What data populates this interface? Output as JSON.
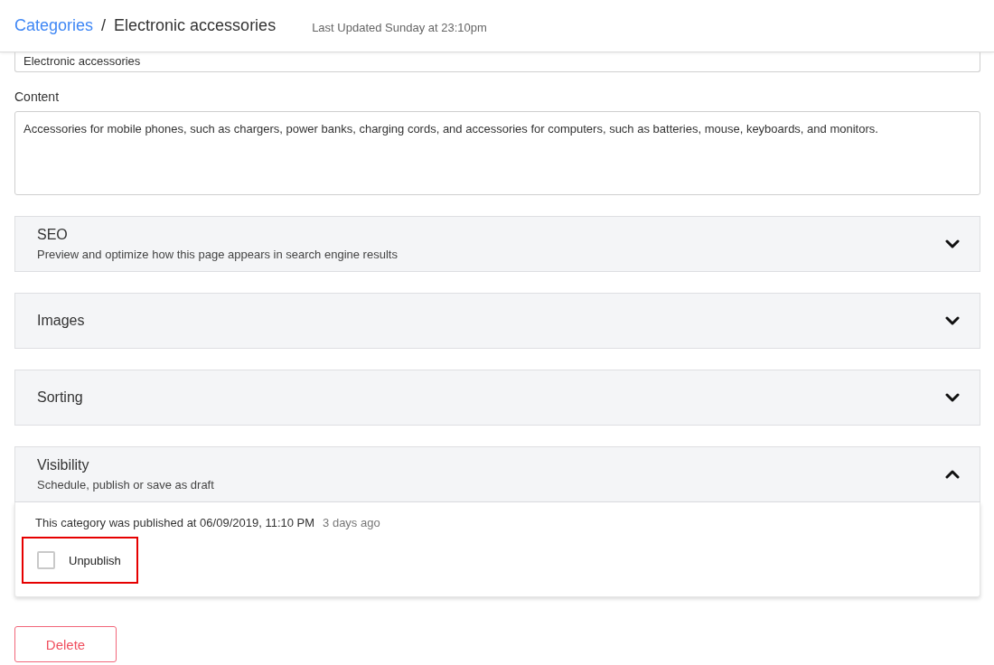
{
  "header": {
    "breadcrumb": [
      {
        "label": "Categories",
        "kind": "link"
      },
      {
        "label": "/",
        "kind": "separator"
      },
      {
        "label": "Electronic accessories",
        "kind": "current"
      }
    ],
    "last_updated": "Last Updated Sunday at 23:10pm"
  },
  "name_field": {
    "value": "Electronic accessories"
  },
  "content_field": {
    "label": "Content",
    "value": "Accessories for mobile phones, such as chargers, power banks, charging cords, and accessories for computers, such as batteries, mouse, keyboards, and monitors."
  },
  "sections": [
    {
      "title": "SEO",
      "subtitle": "Preview and optimize how this page appears in search engine results",
      "expanded": false
    },
    {
      "title": "Images",
      "expanded": false
    },
    {
      "title": "Sorting",
      "expanded": false
    },
    {
      "title": "Visibility",
      "subtitle": "Schedule, publish or save as draft",
      "expanded": true,
      "published_text": "This category was published at 06/09/2019, 11:10 PM",
      "relative_time": "3 days ago",
      "checkbox": {
        "label": "Unpublish",
        "checked": false,
        "highlighted": true
      }
    }
  ],
  "delete_button": {
    "label": "Delete"
  }
}
